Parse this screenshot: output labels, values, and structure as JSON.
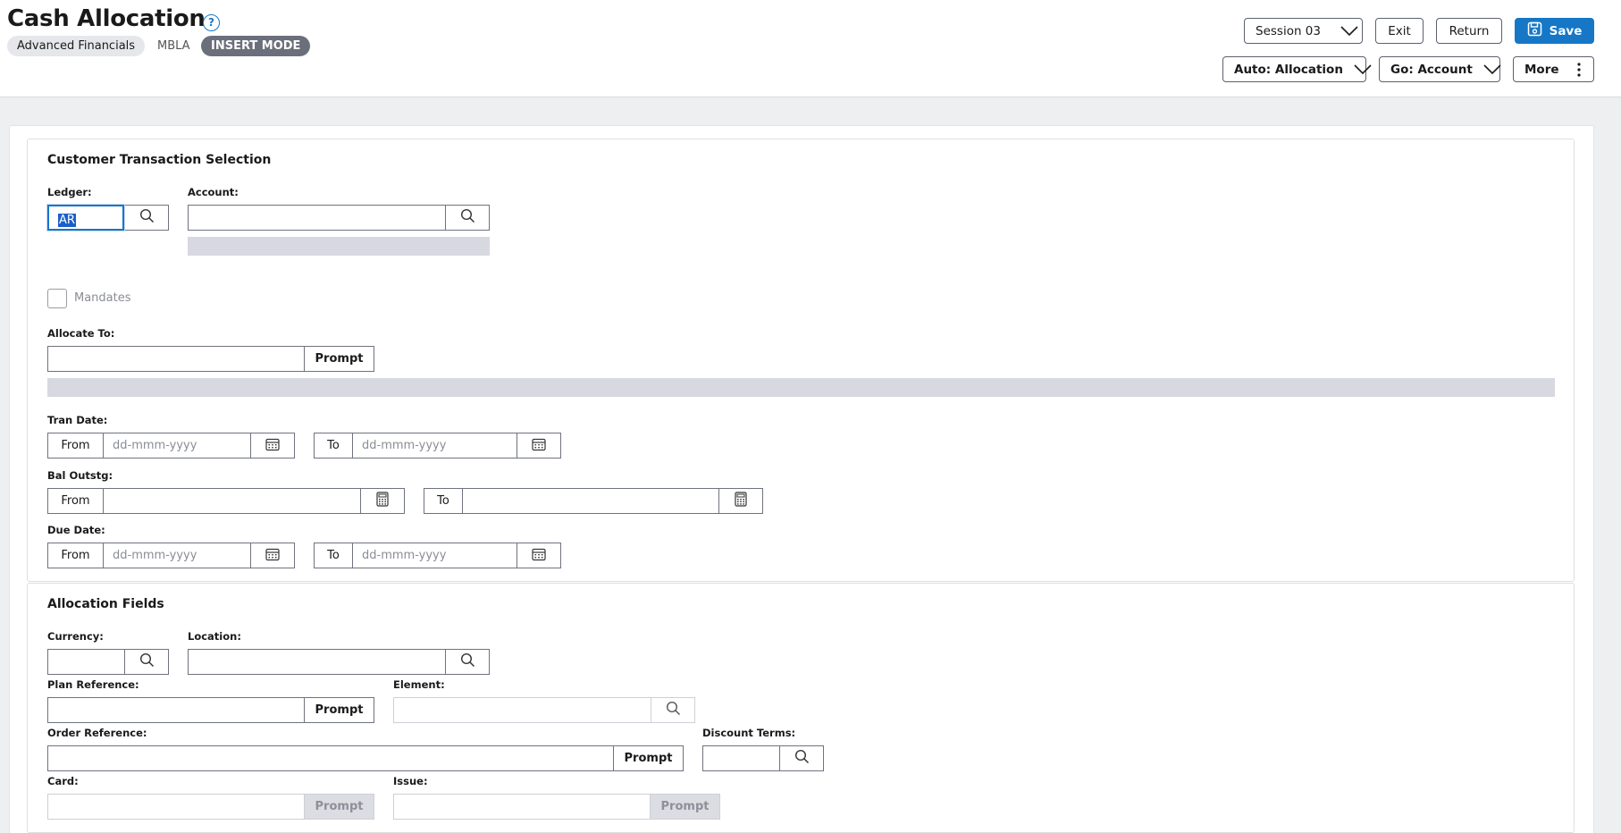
{
  "header": {
    "title": "Cash Allocation",
    "help_icon": "?",
    "app_chip": "Advanced Financials",
    "code": "MBLA",
    "mode": "INSERT MODE",
    "session": "Session 03",
    "exit": "Exit",
    "return": "Return",
    "save": "Save",
    "auto": "Auto: Allocation",
    "go": "Go: Account",
    "more": "More"
  },
  "selection": {
    "title": "Customer Transaction Selection",
    "ledger_label": "Ledger:",
    "ledger_value": "AR",
    "account_label": "Account:",
    "mandates_label": "Mandates",
    "allocate_label": "Allocate To:",
    "prompt": "Prompt",
    "tran_date_label": "Tran Date:",
    "bal_outstg_label": "Bal Outstg:",
    "due_date_label": "Due Date:",
    "from": "From",
    "to": "To",
    "date_placeholder": "dd-mmm-yyyy"
  },
  "allocation": {
    "title": "Allocation Fields",
    "currency_label": "Currency:",
    "location_label": "Location:",
    "plan_ref_label": "Plan Reference:",
    "element_label": "Element:",
    "order_ref_label": "Order Reference:",
    "discount_terms_label": "Discount Terms:",
    "card_label": "Card:",
    "issue_label": "Issue:",
    "prompt": "Prompt"
  },
  "colors": {
    "accent": "#1677c6",
    "mode_chip": "#6b6f7b",
    "desc_bar": "#d7d8e0"
  },
  "icons": [
    "help-icon",
    "chevron-down-icon",
    "save-icon",
    "more-vertical-icon",
    "search-icon",
    "calendar-icon",
    "calculator-icon"
  ]
}
